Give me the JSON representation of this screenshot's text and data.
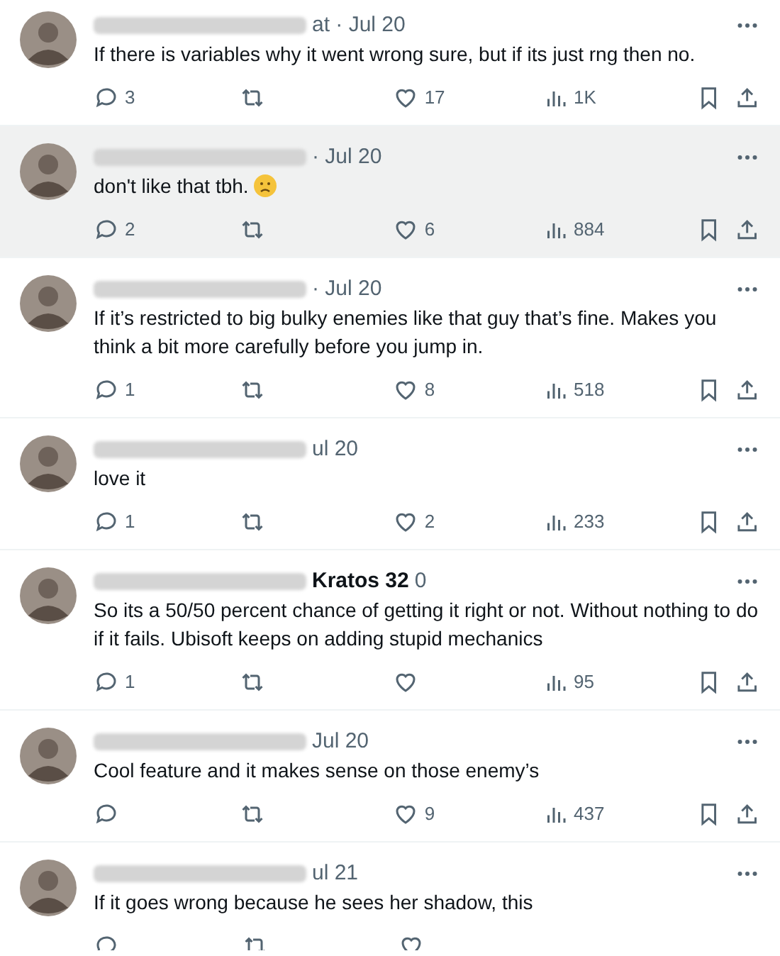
{
  "replies": [
    {
      "meta": "at · Jul 20",
      "text": "If there is variables why it went wrong sure, but if its just rng then no.",
      "replies": "3",
      "likes": "17",
      "views": "1K",
      "highlighted": false
    },
    {
      "meta": "· Jul 20",
      "text": "don't like that tbh.",
      "emoji": true,
      "replies": "2",
      "likes": "6",
      "views": "884",
      "highlighted": true
    },
    {
      "meta": "· Jul 20",
      "text": "If it’s restricted to big bulky enemies like that guy that’s fine. Makes you think a bit more carefully before you jump in.",
      "replies": "1",
      "likes": "8",
      "views": "518",
      "highlighted": false
    },
    {
      "meta": "ul 20",
      "text": "love it",
      "replies": "1",
      "likes": "2",
      "views": "233",
      "highlighted": false
    },
    {
      "name": "Kratos 32",
      "meta": "0",
      "text": "So its a 50/50 percent chance of getting it right or not. Without nothing to do if it fails. Ubisoft keeps on adding stupid mechanics",
      "replies": "1",
      "views": "95",
      "highlighted": false
    },
    {
      "meta": "Jul 20",
      "text": "Cool feature and it makes sense on those enemy’s",
      "likes": "9",
      "views": "437",
      "highlighted": false
    },
    {
      "meta": "ul 21",
      "text": "If it goes wrong because he sees her shadow, this",
      "highlighted": false
    }
  ]
}
